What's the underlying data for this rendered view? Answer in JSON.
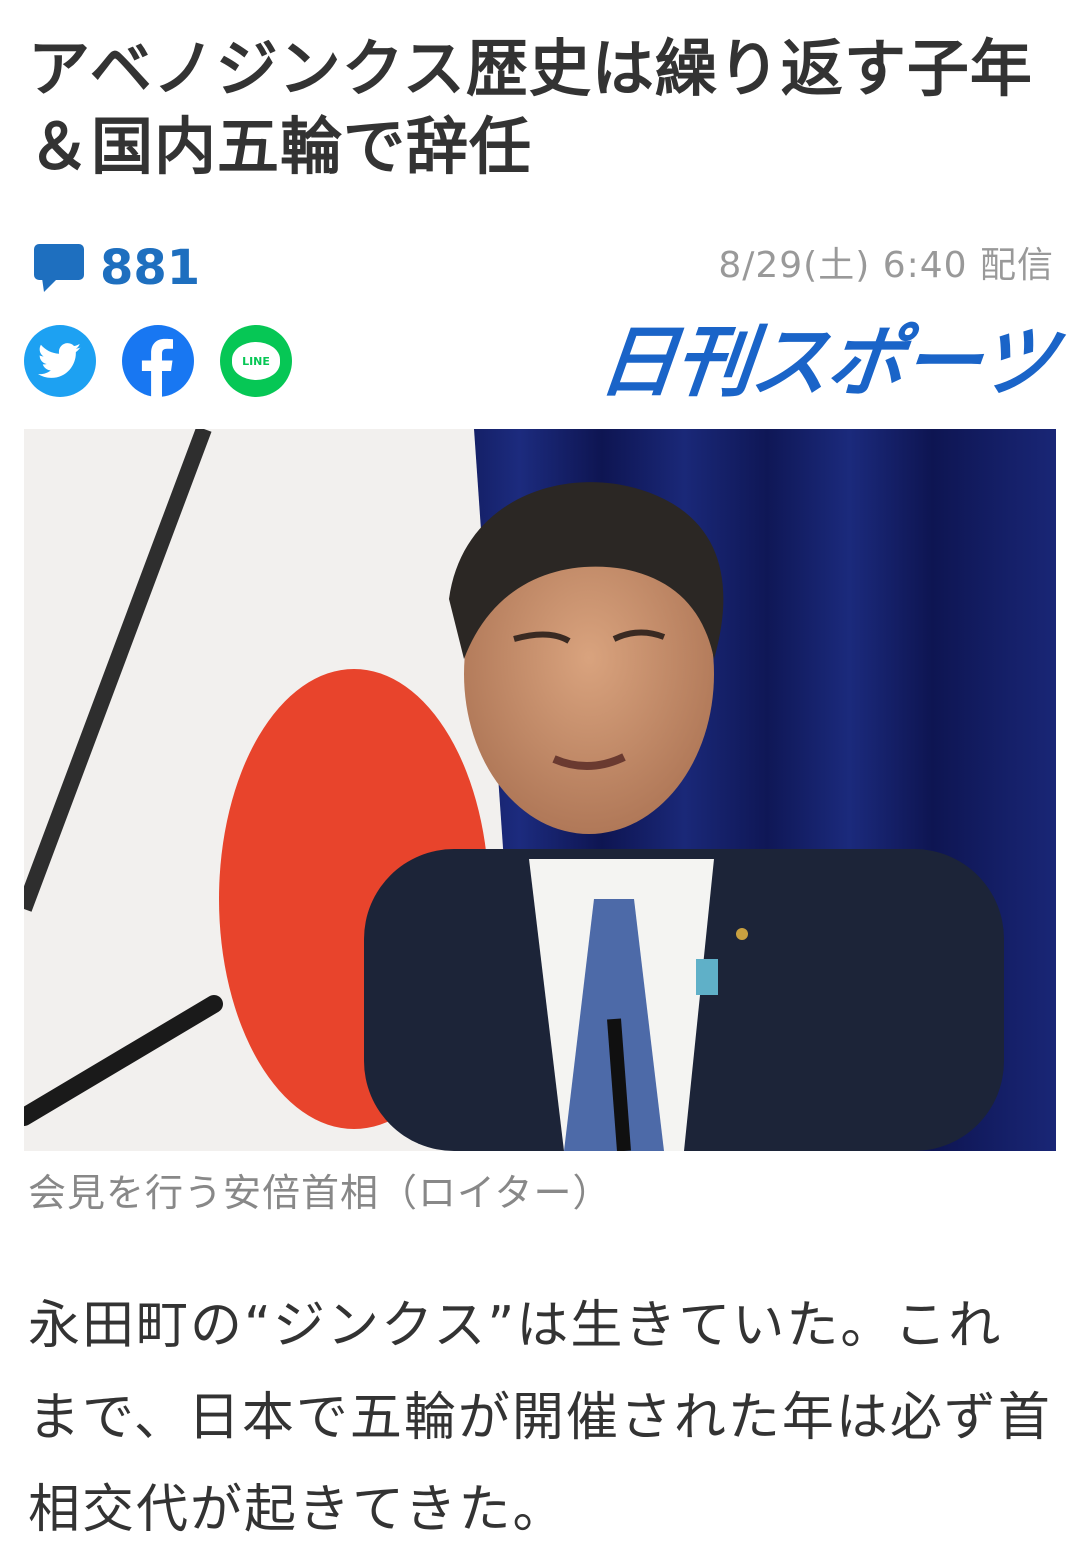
{
  "article": {
    "headline": "アベノジンクス歴史は繰り返す子年＆国内五輪で辞任",
    "comment_count": "881",
    "date": "8/29(土) 6:40 配信",
    "publisher": "日刊スポーツ",
    "photo_caption": "会見を行う安倍首相（ロイター）",
    "body": "永田町の“ジンクス”は生きていた。これまで、日本で五輪が開催された年は必ず首相交代が起きてきた。"
  },
  "share": {
    "line_label": "LINE"
  },
  "colors": {
    "accent_blue": "#1e6fbf",
    "publisher_blue": "#1a64c8",
    "twitter": "#1da1f2",
    "facebook": "#1877f2",
    "line": "#06c755"
  },
  "icons": [
    "comment-icon",
    "twitter-icon",
    "facebook-icon",
    "line-icon"
  ]
}
